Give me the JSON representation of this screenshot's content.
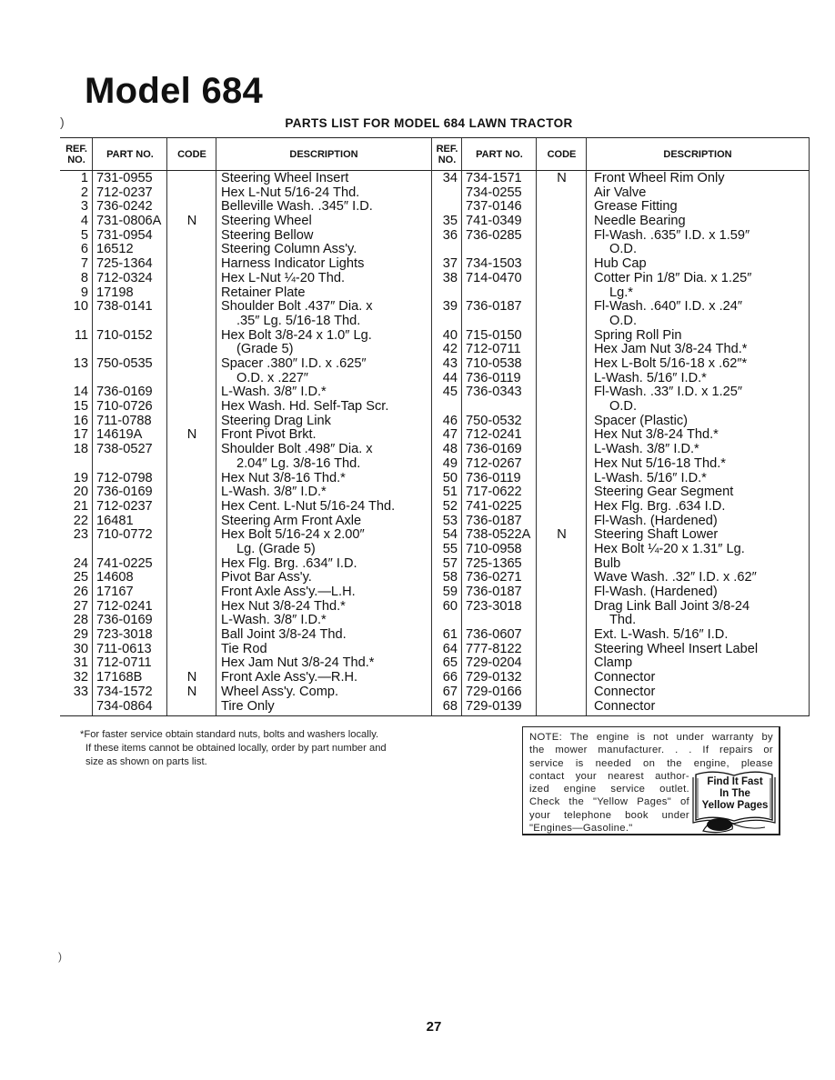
{
  "page": {
    "title": "Model 684",
    "subtitle": "PARTS LIST FOR MODEL 684 LAWN TRACTOR",
    "page_number": "27"
  },
  "table": {
    "headers": {
      "ref": "REF. NO.",
      "part": "PART NO.",
      "code": "CODE",
      "description": "DESCRIPTION"
    },
    "left_rows": [
      {
        "ref": "1",
        "part": "731-0955",
        "code": "",
        "desc": [
          "Steering Wheel Insert"
        ]
      },
      {
        "ref": "2",
        "part": "712-0237",
        "code": "",
        "desc": [
          "Hex L-Nut 5/16-24 Thd."
        ]
      },
      {
        "ref": "3",
        "part": "736-0242",
        "code": "",
        "desc": [
          "Belleville Wash. .345″ I.D."
        ]
      },
      {
        "ref": "4",
        "part": "731-0806A",
        "code": "N",
        "desc": [
          "Steering Wheel"
        ]
      },
      {
        "ref": "5",
        "part": "731-0954",
        "code": "",
        "desc": [
          "Steering Bellow"
        ]
      },
      {
        "ref": "6",
        "part": "16512",
        "code": "",
        "desc": [
          "Steering Column Ass'y."
        ]
      },
      {
        "ref": "7",
        "part": "725-1364",
        "code": "",
        "desc": [
          "Harness Indicator Lights"
        ]
      },
      {
        "ref": "8",
        "part": "712-0324",
        "code": "",
        "desc": [
          "Hex L-Nut ¼-20 Thd."
        ]
      },
      {
        "ref": "9",
        "part": "17198",
        "code": "",
        "desc": [
          "Retainer Plate"
        ]
      },
      {
        "ref": "10",
        "part": "738-0141",
        "code": "",
        "desc": [
          "Shoulder Bolt .437″ Dia. x",
          ".35″ Lg. 5/16-18 Thd."
        ]
      },
      {
        "ref": "11",
        "part": "710-0152",
        "code": "",
        "desc": [
          "Hex Bolt 3/8-24 x 1.0″ Lg.",
          "(Grade 5)"
        ]
      },
      {
        "ref": "13",
        "part": "750-0535",
        "code": "",
        "desc": [
          "Spacer .380″ I.D. x .625″",
          "O.D. x .227″"
        ]
      },
      {
        "ref": "14",
        "part": "736-0169",
        "code": "",
        "desc": [
          "L-Wash. 3/8″ I.D.*"
        ]
      },
      {
        "ref": "15",
        "part": "710-0726",
        "code": "",
        "desc": [
          "Hex Wash. Hd. Self-Tap Scr."
        ]
      },
      {
        "ref": "16",
        "part": "711-0788",
        "code": "",
        "desc": [
          "Steering Drag Link"
        ]
      },
      {
        "ref": "17",
        "part": "14619A",
        "code": "N",
        "desc": [
          "Front Pivot Brkt."
        ]
      },
      {
        "ref": "18",
        "part": "738-0527",
        "code": "",
        "desc": [
          "Shoulder Bolt .498″ Dia. x",
          "2.04″ Lg. 3/8-16 Thd."
        ]
      },
      {
        "ref": "19",
        "part": "712-0798",
        "code": "",
        "desc": [
          "Hex Nut 3/8-16 Thd.*"
        ]
      },
      {
        "ref": "20",
        "part": "736-0169",
        "code": "",
        "desc": [
          "L-Wash. 3/8″ I.D.*"
        ]
      },
      {
        "ref": "21",
        "part": "712-0237",
        "code": "",
        "desc": [
          "Hex Cent. L-Nut 5/16-24 Thd."
        ]
      },
      {
        "ref": "22",
        "part": "16481",
        "code": "",
        "desc": [
          "Steering Arm Front Axle"
        ]
      },
      {
        "ref": "23",
        "part": "710-0772",
        "code": "",
        "desc": [
          "Hex Bolt 5/16-24 x 2.00″",
          "Lg. (Grade 5)"
        ]
      },
      {
        "ref": "24",
        "part": "741-0225",
        "code": "",
        "desc": [
          "Hex Flg. Brg. .634″ I.D."
        ]
      },
      {
        "ref": "25",
        "part": "14608",
        "code": "",
        "desc": [
          "Pivot Bar Ass'y."
        ]
      },
      {
        "ref": "26",
        "part": "17167",
        "code": "",
        "desc": [
          "Front Axle Ass'y.—L.H."
        ]
      },
      {
        "ref": "27",
        "part": "712-0241",
        "code": "",
        "desc": [
          "Hex Nut 3/8-24 Thd.*"
        ]
      },
      {
        "ref": "28",
        "part": "736-0169",
        "code": "",
        "desc": [
          "L-Wash. 3/8″ I.D.*"
        ]
      },
      {
        "ref": "29",
        "part": "723-3018",
        "code": "",
        "desc": [
          "Ball Joint 3/8-24 Thd."
        ]
      },
      {
        "ref": "30",
        "part": "711-0613",
        "code": "",
        "desc": [
          "Tie Rod"
        ]
      },
      {
        "ref": "31",
        "part": "712-0711",
        "code": "",
        "desc": [
          "Hex Jam Nut 3/8-24 Thd.*"
        ]
      },
      {
        "ref": "32",
        "part": "17168B",
        "code": "N",
        "desc": [
          "Front Axle Ass'y.—R.H."
        ]
      },
      {
        "ref": "33",
        "part": "734-1572",
        "code": "N",
        "desc": [
          "Wheel Ass'y. Comp."
        ]
      },
      {
        "ref": "",
        "part": "734-0864",
        "code": "",
        "desc": [
          "Tire Only"
        ]
      }
    ],
    "right_rows": [
      {
        "ref": "34",
        "part": "734-1571",
        "code": "N",
        "desc": [
          "Front Wheel Rim Only"
        ]
      },
      {
        "ref": "",
        "part": "734-0255",
        "code": "",
        "desc": [
          "Air Valve"
        ]
      },
      {
        "ref": "",
        "part": "737-0146",
        "code": "",
        "desc": [
          "Grease Fitting"
        ]
      },
      {
        "ref": "35",
        "part": "741-0349",
        "code": "",
        "desc": [
          "Needle Bearing"
        ]
      },
      {
        "ref": "36",
        "part": "736-0285",
        "code": "",
        "desc": [
          "Fl-Wash. .635″ I.D. x 1.59″",
          "O.D."
        ]
      },
      {
        "ref": "37",
        "part": "734-1503",
        "code": "",
        "desc": [
          "Hub Cap"
        ]
      },
      {
        "ref": "38",
        "part": "714-0470",
        "code": "",
        "desc": [
          "Cotter Pin 1/8″ Dia. x 1.25″",
          "Lg.*"
        ]
      },
      {
        "ref": "39",
        "part": "736-0187",
        "code": "",
        "desc": [
          "Fl-Wash. .640″ I.D. x .24″",
          "O.D."
        ]
      },
      {
        "ref": "40",
        "part": "715-0150",
        "code": "",
        "desc": [
          "Spring Roll Pin"
        ]
      },
      {
        "ref": "42",
        "part": "712-0711",
        "code": "",
        "desc": [
          "Hex Jam Nut 3/8-24 Thd.*"
        ]
      },
      {
        "ref": "43",
        "part": "710-0538",
        "code": "",
        "desc": [
          "Hex L-Bolt 5/16-18 x .62″*"
        ]
      },
      {
        "ref": "44",
        "part": "736-0119",
        "code": "",
        "desc": [
          "L-Wash. 5/16″ I.D.*"
        ]
      },
      {
        "ref": "45",
        "part": "736-0343",
        "code": "",
        "desc": [
          "Fl-Wash. .33″ I.D. x 1.25″",
          "O.D."
        ]
      },
      {
        "ref": "46",
        "part": "750-0532",
        "code": "",
        "desc": [
          "Spacer (Plastic)"
        ]
      },
      {
        "ref": "47",
        "part": "712-0241",
        "code": "",
        "desc": [
          "Hex Nut 3/8-24 Thd.*"
        ]
      },
      {
        "ref": "48",
        "part": "736-0169",
        "code": "",
        "desc": [
          "L-Wash. 3/8″ I.D.*"
        ]
      },
      {
        "ref": "49",
        "part": "712-0267",
        "code": "",
        "desc": [
          "Hex Nut 5/16-18 Thd.*"
        ]
      },
      {
        "ref": "50",
        "part": "736-0119",
        "code": "",
        "desc": [
          "L-Wash. 5/16″ I.D.*"
        ]
      },
      {
        "ref": "51",
        "part": "717-0622",
        "code": "",
        "desc": [
          "Steering Gear Segment"
        ]
      },
      {
        "ref": "52",
        "part": "741-0225",
        "code": "",
        "desc": [
          "Hex Flg. Brg. .634 I.D."
        ]
      },
      {
        "ref": "53",
        "part": "736-0187",
        "code": "",
        "desc": [
          "Fl-Wash. (Hardened)"
        ]
      },
      {
        "ref": "54",
        "part": "738-0522A",
        "code": "N",
        "desc": [
          "Steering Shaft Lower"
        ]
      },
      {
        "ref": "55",
        "part": "710-0958",
        "code": "",
        "desc": [
          "Hex Bolt ¼-20 x 1.31″ Lg."
        ]
      },
      {
        "ref": "57",
        "part": "725-1365",
        "code": "",
        "desc": [
          "Bulb"
        ]
      },
      {
        "ref": "58",
        "part": "736-0271",
        "code": "",
        "desc": [
          "Wave Wash. .32″ I.D. x .62″"
        ]
      },
      {
        "ref": "59",
        "part": "736-0187",
        "code": "",
        "desc": [
          "Fl-Wash. (Hardened)"
        ]
      },
      {
        "ref": "60",
        "part": "723-3018",
        "code": "",
        "desc": [
          "Drag Link Ball Joint 3/8-24",
          "Thd."
        ]
      },
      {
        "ref": "61",
        "part": "736-0607",
        "code": "",
        "desc": [
          "Ext. L-Wash. 5/16″ I.D."
        ]
      },
      {
        "ref": "64",
        "part": "777-8122",
        "code": "",
        "desc": [
          "Steering Wheel Insert Label"
        ]
      },
      {
        "ref": "65",
        "part": "729-0204",
        "code": "",
        "desc": [
          "Clamp"
        ]
      },
      {
        "ref": "66",
        "part": "729-0132",
        "code": "",
        "desc": [
          "Connector"
        ]
      },
      {
        "ref": "67",
        "part": "729-0166",
        "code": "",
        "desc": [
          "Connector"
        ]
      },
      {
        "ref": "68",
        "part": "729-0139",
        "code": "",
        "desc": [
          "Connector"
        ]
      }
    ]
  },
  "footnote": {
    "lines": [
      "*For faster service obtain standard nuts, bolts and washers locally.",
      "If these items cannot be obtained locally, order by part number and",
      "size as shown on parts list."
    ]
  },
  "note_box": {
    "full_lines": [
      "NOTE: The engine is not under warranty by",
      "the mower manufacturer. . . If repairs or",
      "service is needed on the engine, please"
    ],
    "narrow_lines": [
      "contact your nearest author-",
      "ized engine service outlet.",
      "Check the \"Yellow Pages\" of",
      "your telephone book under",
      "\"Engines—Gasoline.\""
    ],
    "badge_lines": [
      "Find It Fast",
      "In The",
      "Yellow Pages"
    ]
  }
}
